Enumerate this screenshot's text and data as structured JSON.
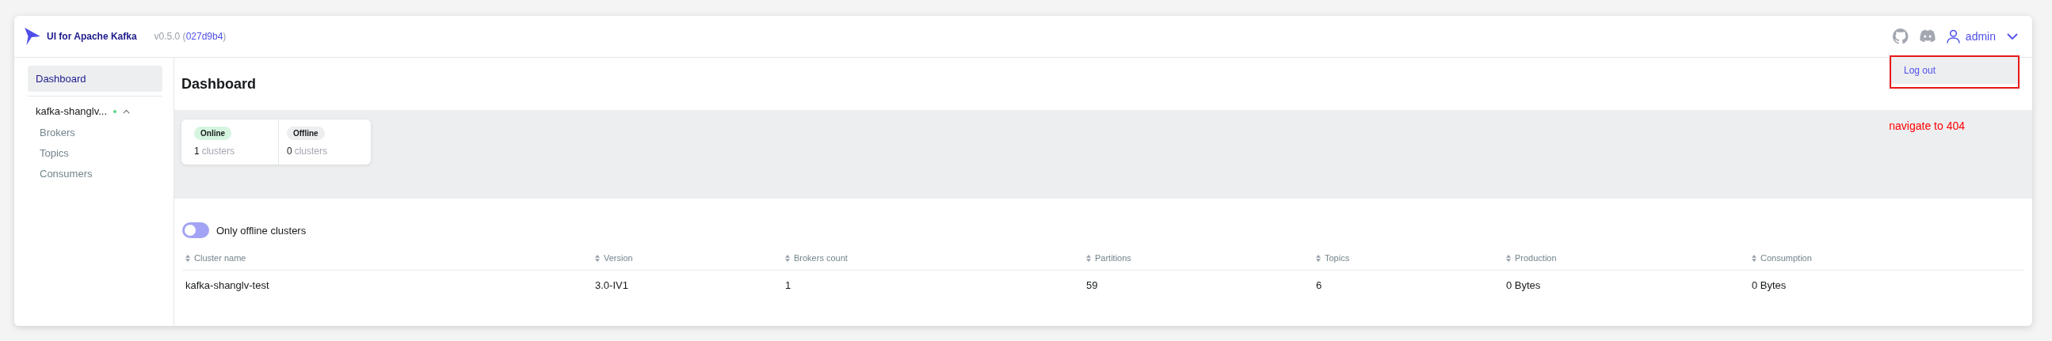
{
  "header": {
    "app_name": "UI for Apache Kafka",
    "version": "v0.5.0 (",
    "commit": "027d9b4",
    "version_end": ")",
    "user": "admin"
  },
  "user_menu": {
    "items": [
      "Log out"
    ],
    "highlighted": true
  },
  "annotation": "navigate to 404",
  "sidebar": {
    "items": [
      {
        "label": "Dashboard",
        "selected": true
      }
    ],
    "cluster": {
      "name": "kafka-shanglv...",
      "expanded": true,
      "online": true,
      "children": [
        {
          "label": "Brokers",
          "selected": false
        },
        {
          "label": "Topics",
          "selected": false
        },
        {
          "label": "Consumers",
          "selected": false
        }
      ]
    }
  },
  "page_title": "Dashboard",
  "stats": [
    {
      "badge": "Online",
      "count": "1",
      "unit": "clusters",
      "kind": "online"
    },
    {
      "badge": "Offline",
      "count": "0",
      "unit": "clusters",
      "kind": "offline"
    }
  ],
  "filter": {
    "label": "Only offline clusters",
    "on": false
  },
  "table": {
    "columns": [
      "Cluster name",
      "Version",
      "Brokers count",
      "Partitions",
      "Topics",
      "Production",
      "Consumption"
    ],
    "rows": [
      [
        "kafka-shanglv-test",
        "3.0-IV1",
        "1",
        "59",
        "6",
        "0 Bytes",
        "0 Bytes"
      ]
    ]
  }
}
